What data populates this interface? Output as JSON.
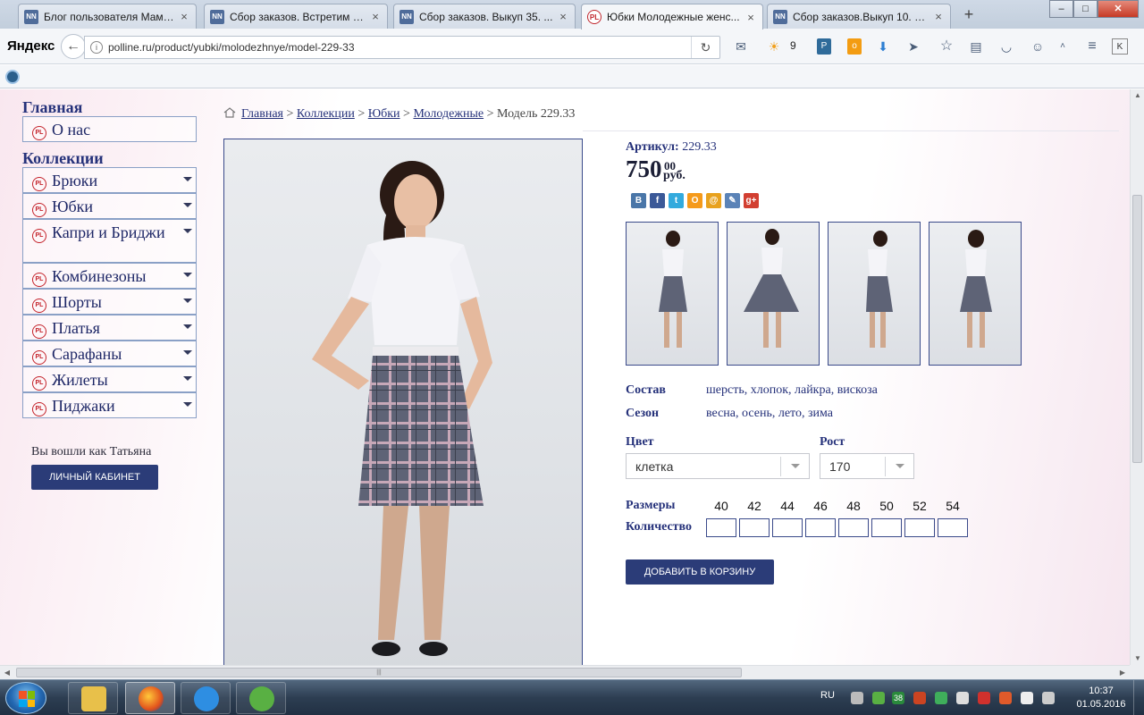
{
  "browser": {
    "tabs": [
      {
        "title": "Блог пользователя Мама ...",
        "fav": "NN"
      },
      {
        "title": "Сбор заказов. Встретим в...",
        "fav": "NN"
      },
      {
        "title": "Сбор заказов. Выкуп 35. ...",
        "fav": "NN"
      },
      {
        "title": "Юбки Молодежные женс...",
        "fav": "PL"
      },
      {
        "title": "Сбор заказов.Выкуп 10. В...",
        "fav": "NN"
      }
    ],
    "new_tab": "+",
    "logo": "Яндекс",
    "url": "polline.ru/product/yubki/molodezhnye/model-229-33",
    "weather_temp": "9"
  },
  "sidebar": {
    "main_heading": "Главная",
    "about": "О нас",
    "collections_heading": "Коллекции",
    "categories": [
      "Брюки",
      "Юбки",
      "Капри и Бриджи",
      "Комбинезоны",
      "Шорты",
      "Платья",
      "Сарафаны",
      "Жилеты",
      "Пиджаки"
    ],
    "logged_in": "Вы вошли как Татьяна",
    "cabinet_button": "ЛИЧНЫЙ КАБИНЕТ",
    "badge": "PL"
  },
  "breadcrumb": {
    "items": [
      "Главная",
      "Коллекции",
      "Юбки",
      "Молодежные"
    ],
    "separator": ">",
    "current": "Модель 229.33"
  },
  "product": {
    "article_label": "Артикул:",
    "article_value": "229.33",
    "price_main": "750",
    "price_cents": "00",
    "price_currency": "руб.",
    "share_icons": [
      "В",
      "f",
      "t",
      "О",
      "@",
      "✎",
      "g+"
    ],
    "composition_label": "Состав",
    "composition_value": "шерсть, хлопок, лайкра, вискоза",
    "season_label": "Сезон",
    "season_value": "весна, осень, лето, зима",
    "color_label": "Цвет",
    "color_value": "клетка",
    "height_label": "Рост",
    "height_value": "170",
    "sizes_label": "Размеры",
    "quantity_label": "Количество",
    "sizes": [
      "40",
      "42",
      "44",
      "46",
      "48",
      "50",
      "52",
      "54"
    ],
    "add_to_cart": "ДОБАВИТЬ В КОРЗИНУ"
  },
  "taskbar": {
    "lang": "RU",
    "time": "10:37",
    "date": "01.05.2016",
    "tray_badge": "38"
  },
  "colors": {
    "brand_navy": "#2b3c78",
    "link": "#25317a",
    "logo_red": "#c4232b"
  }
}
